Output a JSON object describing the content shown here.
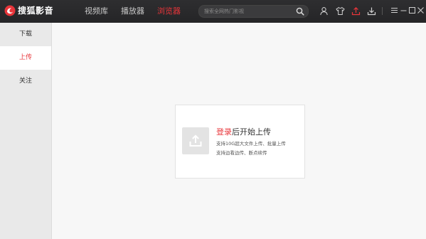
{
  "app": {
    "title": "搜狐影音"
  },
  "nav": {
    "tabs": [
      {
        "label": "视频库"
      },
      {
        "label": "播放器"
      },
      {
        "label": "浏览器",
        "active": true
      }
    ]
  },
  "search": {
    "placeholder": "搜索全网热门影视",
    "icon": "search-icon"
  },
  "toolbar": {
    "icons": [
      "user-icon",
      "tshirt-icon",
      "upload-icon",
      "download-icon"
    ]
  },
  "window": {
    "controls": [
      "menu-icon",
      "minimize-icon",
      "maximize-icon",
      "close-icon"
    ]
  },
  "sidebar": {
    "items": [
      {
        "label": "下载"
      },
      {
        "label": "上传",
        "active": true
      },
      {
        "label": "关注"
      }
    ]
  },
  "upload_card": {
    "login_link": "登录",
    "title_rest": "后开始上传",
    "line1": "支持10G超大文件上传、批量上传",
    "line2": "支持边看边传、断点续传",
    "icon": "upload-icon"
  },
  "colors": {
    "accent": "#e8353a",
    "topbar": "#2a2a2c",
    "sidebar": "#e9e9e9"
  }
}
